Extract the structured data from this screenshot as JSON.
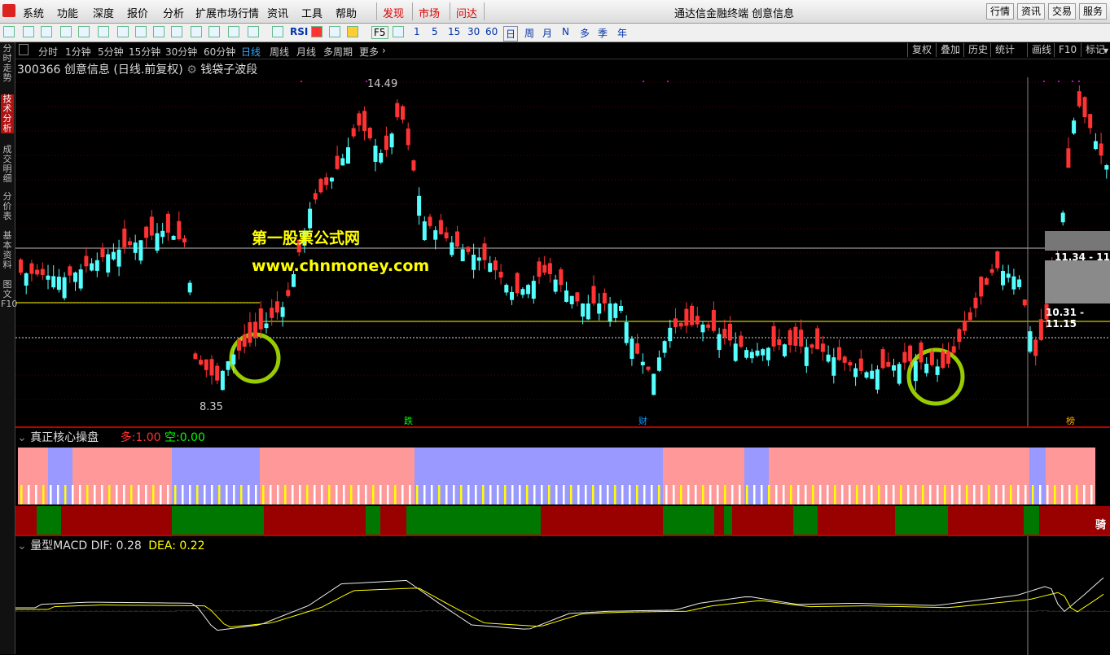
{
  "menu": {
    "items": [
      "系统",
      "功能",
      "深度",
      "报价",
      "分析",
      "扩展市场行情",
      "资讯",
      "工具",
      "帮助"
    ],
    "highlight": [
      "发现",
      "市场",
      "问达"
    ],
    "app_title": "通达信金融终端 创意信息",
    "right_buttons": [
      "行情",
      "资讯",
      "交易",
      "服务"
    ]
  },
  "toolbar": {
    "labels": [
      "RSI",
      "F5",
      "1",
      "5",
      "15",
      "30",
      "60",
      "日",
      "周",
      "月",
      "N",
      "多",
      "季",
      "年"
    ]
  },
  "sidebar": {
    "items": [
      "分时走势",
      "技术分析",
      "成交明细",
      "分价表",
      "基本资料",
      "图文F10"
    ],
    "active_index": 1
  },
  "period_tabs": {
    "items": [
      "分时",
      "1分钟",
      "5分钟",
      "15分钟",
      "30分钟",
      "60分钟",
      "日线",
      "周线",
      "月线",
      "多周期",
      "更多"
    ],
    "active": "日线",
    "right_buttons": [
      "复权",
      "叠加",
      "历史",
      "统计",
      "画线",
      "F10",
      "标记"
    ]
  },
  "main_chart": {
    "code": "300366",
    "name": "创意信息",
    "mode": "(日线.前复权)",
    "indicator": "钱袋子波段",
    "high_label": "14.49",
    "low_label": "8.35",
    "price_box_1": "11.34 - 11",
    "price_box_2": "10.31 - 11.15",
    "watermark_cn": "第一股票公式网",
    "watermark_url": "www.chnmoney.com",
    "event_markers": [
      "跌",
      "财",
      "榜"
    ]
  },
  "panel2": {
    "title": "真正核心操盘",
    "long_label": "多:",
    "long_value": "1.00",
    "short_label": "空:",
    "short_value": "0.00",
    "edge_text": "骑"
  },
  "panel3": {
    "title": "量型MACD",
    "dif_label": "DIF:",
    "dif_value": "0.28",
    "dea_label": "DEA:",
    "dea_value": "0.22"
  },
  "colors": {
    "up": "#ff3333",
    "down": "#54ffff",
    "accent": "#ffff00",
    "bg": "#000000"
  }
}
